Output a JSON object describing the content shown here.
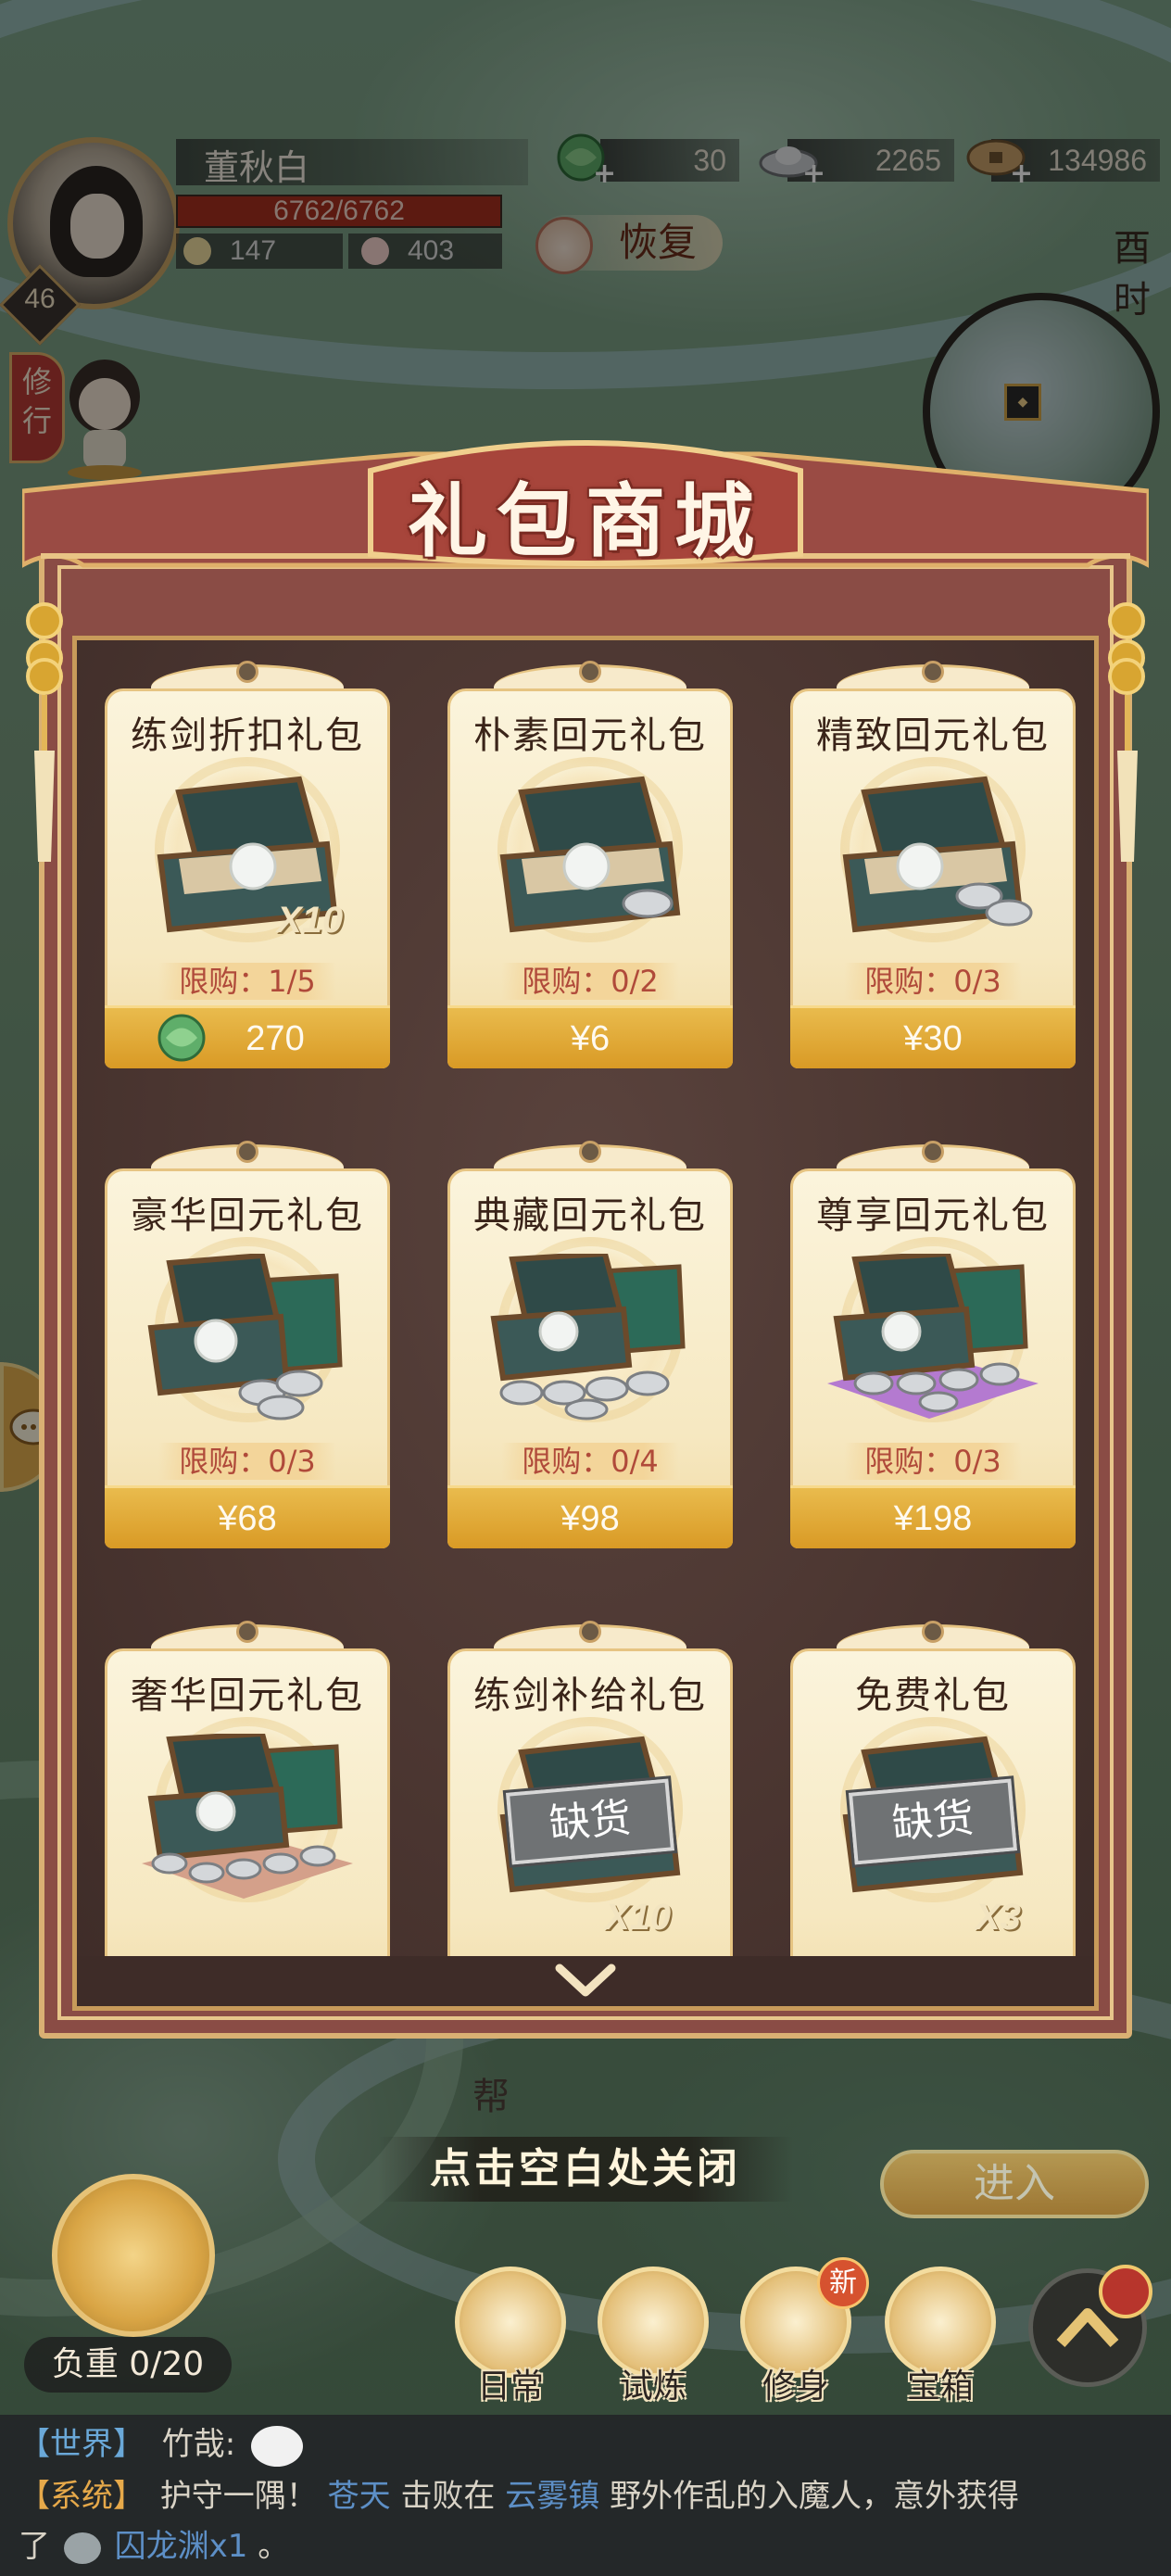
{
  "player": {
    "name": "董秋白",
    "level": "46",
    "hp": "6762/6762",
    "stamina": "147",
    "food": "403"
  },
  "currencies": [
    {
      "icon": "jade-dragon-icon",
      "value": "30"
    },
    {
      "icon": "silver-ingot-icon",
      "value": "2265"
    },
    {
      "icon": "copper-coin-icon",
      "value": "134986"
    }
  ],
  "restore_label": "恢复",
  "time_label": "酉时",
  "practice_tab": "修行",
  "shop": {
    "title": "礼包商城",
    "packs": [
      {
        "name": "练剑折扣礼包",
        "limit": "限购：1/5",
        "price": "270",
        "price_icon": "jade-dragon-icon",
        "multiplier": "X10",
        "sold_out": false
      },
      {
        "name": "朴素回元礼包",
        "limit": "限购：0/2",
        "price": "¥6",
        "multiplier": "",
        "sold_out": false
      },
      {
        "name": "精致回元礼包",
        "limit": "限购：0/3",
        "price": "¥30",
        "multiplier": "",
        "sold_out": false
      },
      {
        "name": "豪华回元礼包",
        "limit": "限购：0/3",
        "price": "¥68",
        "multiplier": "",
        "sold_out": false
      },
      {
        "name": "典藏回元礼包",
        "limit": "限购：0/4",
        "price": "¥98",
        "multiplier": "",
        "sold_out": false
      },
      {
        "name": "尊享回元礼包",
        "limit": "限购：0/3",
        "price": "¥198",
        "multiplier": "",
        "sold_out": false
      },
      {
        "name": "奢华回元礼包",
        "limit": "",
        "price": "",
        "multiplier": "",
        "sold_out": false
      },
      {
        "name": "练剑补给礼包",
        "limit": "",
        "price": "",
        "multiplier": "X10",
        "sold_out": true,
        "sold_out_label": "缺货"
      },
      {
        "name": "免费礼包",
        "limit": "",
        "price": "",
        "multiplier": "X3",
        "sold_out": true,
        "sold_out_label": "缺货"
      }
    ]
  },
  "close_hint": "点击空白处关闭",
  "enter_label": "进入",
  "gang_label": "帮",
  "weight_label": "负重 0/20",
  "nav": [
    {
      "label": "日常",
      "icon": "daily-icon"
    },
    {
      "label": "试炼",
      "icon": "trial-icon"
    },
    {
      "label": "修身",
      "icon": "cultivate-icon"
    },
    {
      "label": "宝箱",
      "icon": "treasure-chest-icon"
    }
  ],
  "new_badge": "新",
  "chat": {
    "line1": {
      "channel": "【世界】",
      "speaker": "竹哉:"
    },
    "line2": {
      "channel": "【系统】",
      "text_a": "护守一隅！",
      "name": "苍天",
      "text_b": "击败在",
      "place": "云雾镇",
      "text_c": "野外作乱的入魔人，意外获得"
    },
    "line3": {
      "prefix": "了",
      "item": "囚龙渊x1",
      "suffix": "。"
    }
  }
}
